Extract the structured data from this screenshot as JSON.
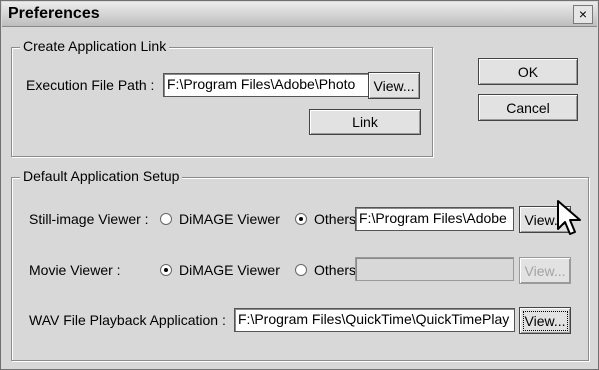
{
  "window": {
    "title": "Preferences",
    "close_glyph": "×"
  },
  "link_group": {
    "legend": "Create Application Link",
    "path_label": "Execution File Path :",
    "path_value": "F:\\Program Files\\Adobe\\Photo",
    "view_label": "View...",
    "link_label": "Link"
  },
  "buttons": {
    "ok": "OK",
    "cancel": "Cancel"
  },
  "setup_group": {
    "legend": "Default Application Setup",
    "still": {
      "label": "Still-image Viewer :",
      "option1": "DiMAGE Viewer",
      "option2": "Others",
      "selected": "Others",
      "path": "F:\\Program Files\\Adobe",
      "view_label": "View..."
    },
    "movie": {
      "label": "Movie Viewer :",
      "option1": "DiMAGE Viewer",
      "option2": "Others",
      "selected": "DiMAGE Viewer",
      "path": "",
      "view_label": "View..."
    },
    "wav": {
      "label": "WAV File Playback Application :",
      "path": "F:\\Program Files\\QuickTime\\QuickTimePlay",
      "view_label": "View..."
    }
  },
  "icons": {
    "cursor": "mouse-pointer-icon"
  }
}
